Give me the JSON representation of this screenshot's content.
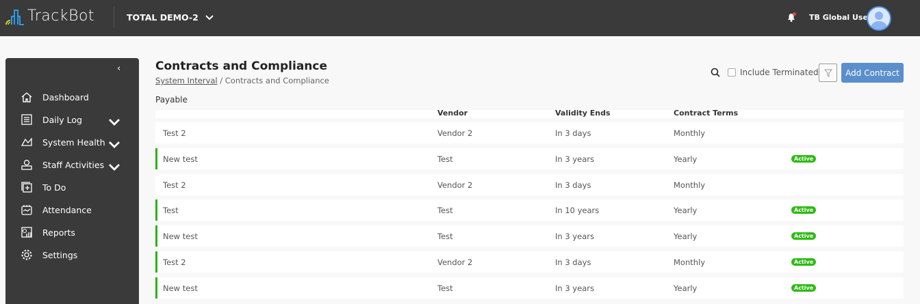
{
  "header": {
    "brand": "TrackBot",
    "org": "TOTAL DEMO-2",
    "user": "TB Global User"
  },
  "sidebar": {
    "items": [
      {
        "label": "Dashboard",
        "icon": "home-icon",
        "expandable": false
      },
      {
        "label": "Daily Log",
        "icon": "list-icon",
        "expandable": true
      },
      {
        "label": "System Health",
        "icon": "health-icon",
        "expandable": true
      },
      {
        "label": "Staff Activities",
        "icon": "staff-icon",
        "expandable": true
      },
      {
        "label": "To Do",
        "icon": "todo-icon",
        "expandable": false
      },
      {
        "label": "Attendance",
        "icon": "attendance-icon",
        "expandable": false
      },
      {
        "label": "Reports",
        "icon": "reports-icon",
        "expandable": false
      },
      {
        "label": "Settings",
        "icon": "gear-icon",
        "expandable": false
      }
    ]
  },
  "page": {
    "title": "Contracts and Compliance",
    "breadcrumb_link": "System Interval",
    "breadcrumb_sep": " / ",
    "breadcrumb_current": "Contracts and Compliance",
    "section": "Payable",
    "include_terminated": "Include Terminated",
    "add_contract": "Add Contract"
  },
  "table": {
    "columns": [
      "Vendor",
      "Validity Ends",
      "Contract Terms"
    ],
    "rows": [
      {
        "name": "Test 2",
        "vendor": "Vendor 2",
        "validity": "In 3 days",
        "terms": "Monthly",
        "status": ""
      },
      {
        "name": "New test",
        "vendor": "Test",
        "validity": "In 3 years",
        "terms": "Yearly",
        "status": "Active"
      },
      {
        "name": "Test 2",
        "vendor": "Vendor 2",
        "validity": "In 3 days",
        "terms": "Monthly",
        "status": ""
      },
      {
        "name": "Test",
        "vendor": "Test",
        "validity": "In 10 years",
        "terms": "Yearly",
        "status": "Active"
      },
      {
        "name": "New test",
        "vendor": "Test",
        "validity": "In 3 years",
        "terms": "Yearly",
        "status": "Active"
      },
      {
        "name": "Test 2",
        "vendor": "Vendor 2",
        "validity": "In 3 days",
        "terms": "Monthly",
        "status": "Active"
      },
      {
        "name": "New test",
        "vendor": "Test",
        "validity": "In 3 years",
        "terms": "Yearly",
        "status": "Active"
      }
    ]
  },
  "colors": {
    "topbar": "#3a3a3a",
    "accent": "#5a8fcb",
    "active": "#2dbb12"
  }
}
